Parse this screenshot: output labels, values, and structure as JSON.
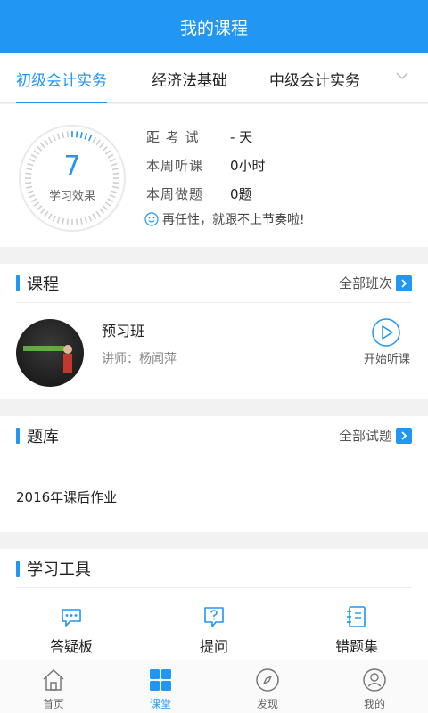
{
  "header": {
    "title": "我的课程"
  },
  "subjects": {
    "tabs": [
      {
        "label": "初级会计实务",
        "active": true
      },
      {
        "label": "经济法基础",
        "active": false
      },
      {
        "label": "中级会计实务",
        "active": false
      }
    ]
  },
  "stats": {
    "gauge_value": "7",
    "gauge_label": "学习效果",
    "rows": [
      {
        "label": "距 考 试",
        "value": "- 天"
      },
      {
        "label": "本周听课",
        "value": "0小时"
      },
      {
        "label": "本周做题",
        "value": "0题"
      }
    ],
    "tip": "再任性，就跟不上节奏啦!"
  },
  "courses": {
    "title": "课程",
    "link": "全部班次",
    "item": {
      "name": "预习班",
      "teacher": "讲师：杨闻萍",
      "action": "开始听课"
    }
  },
  "question_bank": {
    "title": "题库",
    "link": "全部试题",
    "item": "2016年课后作业"
  },
  "tools": {
    "title": "学习工具",
    "items": [
      {
        "label": "答疑板",
        "icon": "chat-bubble-icon"
      },
      {
        "label": "提问",
        "icon": "question-icon"
      },
      {
        "label": "错题集",
        "icon": "notebook-icon"
      }
    ]
  },
  "tabbar": {
    "items": [
      {
        "label": "首页",
        "icon": "home-icon",
        "active": false
      },
      {
        "label": "课堂",
        "icon": "grid-icon",
        "active": true
      },
      {
        "label": "发现",
        "icon": "compass-icon",
        "active": false
      },
      {
        "label": "我的",
        "icon": "user-icon",
        "active": false
      }
    ]
  },
  "colors": {
    "accent": "#2196f3",
    "background": "#f2f2f2"
  }
}
